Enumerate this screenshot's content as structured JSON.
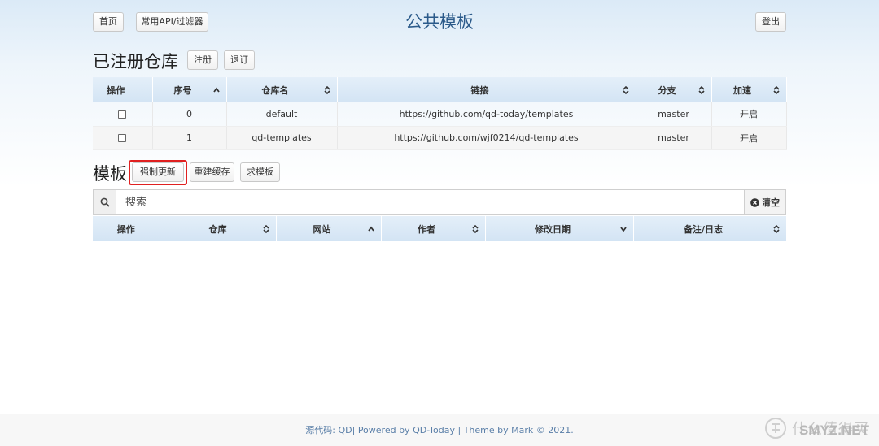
{
  "nav": {
    "home": "首页",
    "api_filter": "常用API/过滤器",
    "page_title": "公共模板",
    "logout": "登出"
  },
  "registry": {
    "title": "已注册仓库",
    "register_button": "注册",
    "unsubscribe_button": "退订",
    "columns": [
      "操作",
      "序号",
      "仓库名",
      "链接",
      "分支",
      "加速"
    ],
    "rows": [
      {
        "index": "0",
        "name": "default",
        "link": "https://github.com/qd-today/templates",
        "branch": "master",
        "proxy": "开启"
      },
      {
        "index": "1",
        "name": "qd-templates",
        "link": "https://github.com/wjf0214/qd-templates",
        "branch": "master",
        "proxy": "开启"
      }
    ]
  },
  "templates": {
    "title": "模板",
    "force_update_button": "强制更新",
    "rebuild_cache_button": "重建缓存",
    "request_template_button": "求模板",
    "search_placeholder": "搜索",
    "clear_button": "清空",
    "columns": [
      "操作",
      "仓库",
      "网站",
      "作者",
      "修改日期",
      "备注/日志"
    ]
  },
  "footer": {
    "text": "源代码: QD| Powered by QD-Today | Theme by Mark © 2021."
  },
  "watermark": {
    "text": "什么值得买",
    "domain": "SMYZ.NET"
  },
  "colors": {
    "accent": "#2b5a8a",
    "highlight": "#e02020",
    "header_bg": "#d3e4f4"
  }
}
